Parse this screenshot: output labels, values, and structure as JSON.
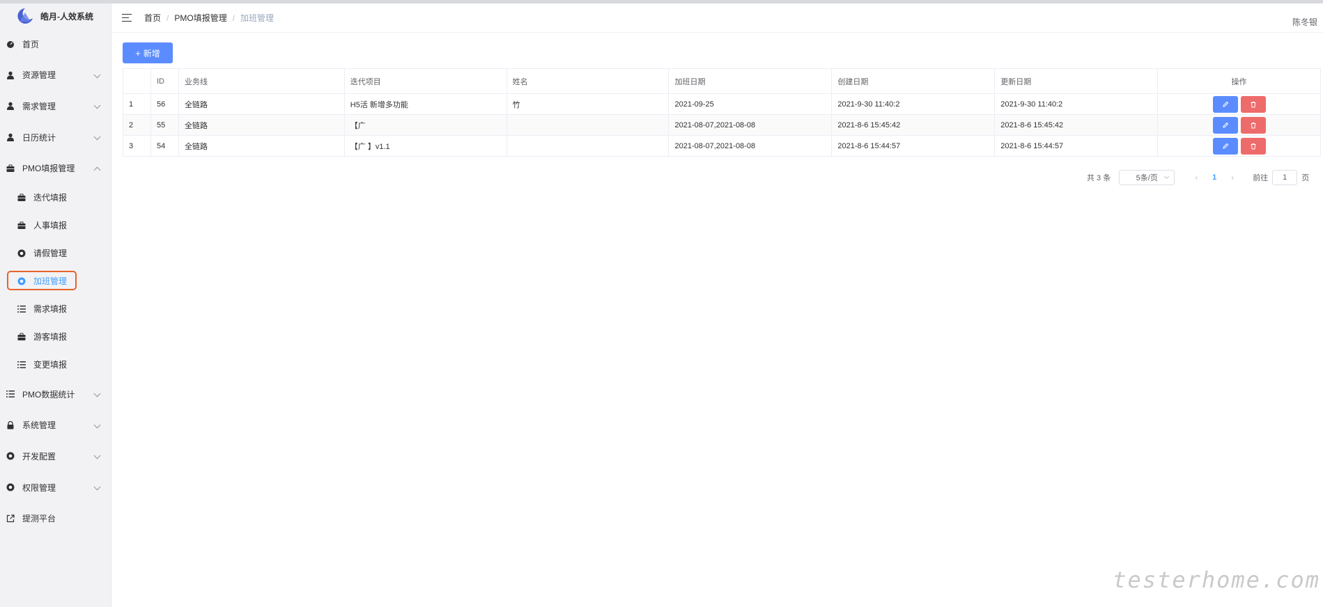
{
  "app": {
    "title": "皓月-人效系统",
    "colors": {
      "primary": "#5b8cff",
      "danger": "#ee6b6b",
      "active_menu": "#409eff",
      "highlight_border": "#e8622a"
    }
  },
  "sidebar": {
    "items": [
      {
        "label": "首页",
        "icon": "dashboard-icon",
        "has_children": false
      },
      {
        "label": "资源管理",
        "icon": "user-icon",
        "has_children": true
      },
      {
        "label": "需求管理",
        "icon": "user-icon",
        "has_children": true
      },
      {
        "label": "日历统计",
        "icon": "user-icon",
        "has_children": true
      },
      {
        "label": "PMO填报管理",
        "icon": "briefcase-icon",
        "has_children": true,
        "expanded": true,
        "children": [
          {
            "label": "迭代填报",
            "icon": "briefcase-icon"
          },
          {
            "label": "人事填报",
            "icon": "briefcase-icon"
          },
          {
            "label": "请假管理",
            "icon": "compass-icon"
          },
          {
            "label": "加班管理",
            "icon": "compass-icon",
            "active": true
          },
          {
            "label": "需求填报",
            "icon": "list-icon"
          },
          {
            "label": "游客填报",
            "icon": "briefcase-icon"
          },
          {
            "label": "变更填报",
            "icon": "list-icon"
          }
        ]
      },
      {
        "label": "PMO数据统计",
        "icon": "list-icon",
        "has_children": true
      },
      {
        "label": "系统管理",
        "icon": "lock-icon",
        "has_children": true
      },
      {
        "label": "开发配置",
        "icon": "compass-icon",
        "has_children": true
      },
      {
        "label": "权限管理",
        "icon": "compass-icon",
        "has_children": true
      },
      {
        "label": "提测平台",
        "icon": "external-link-icon",
        "has_children": false
      }
    ]
  },
  "header": {
    "breadcrumb": [
      "首页",
      "PMO填报管理",
      "加班管理"
    ],
    "user": "陈冬银"
  },
  "toolbar": {
    "add_label": "新增"
  },
  "table": {
    "columns": [
      "",
      "ID",
      "业务线",
      "迭代项目",
      "姓名",
      "加班日期",
      "创建日期",
      "更新日期",
      "操作"
    ],
    "rows": [
      {
        "index": "1",
        "id": "56",
        "line": "全链路",
        "project": "H5活  新增多功能",
        "name": "   竹",
        "ot_date": "2021-09-25",
        "created": "2021-9-30 11:40:2",
        "updated": "2021-9-30 11:40:2"
      },
      {
        "index": "2",
        "id": "55",
        "line": "全链路",
        "project": "【广",
        "name": "",
        "ot_date": "2021-08-07,2021-08-08",
        "created": "2021-8-6 15:45:42",
        "updated": "2021-8-6 15:45:42"
      },
      {
        "index": "3",
        "id": "54",
        "line": "全链路",
        "project": "【广       】v1.1",
        "name": "",
        "ot_date": "2021-08-07,2021-08-08",
        "created": "2021-8-6 15:44:57",
        "updated": "2021-8-6 15:44:57"
      }
    ]
  },
  "pagination": {
    "total": "共 3 条",
    "page_size": "5条/页",
    "current": "1",
    "goto_prefix": "前往",
    "goto_value": "1",
    "goto_suffix": "页"
  },
  "watermark": "testerhome.com"
}
